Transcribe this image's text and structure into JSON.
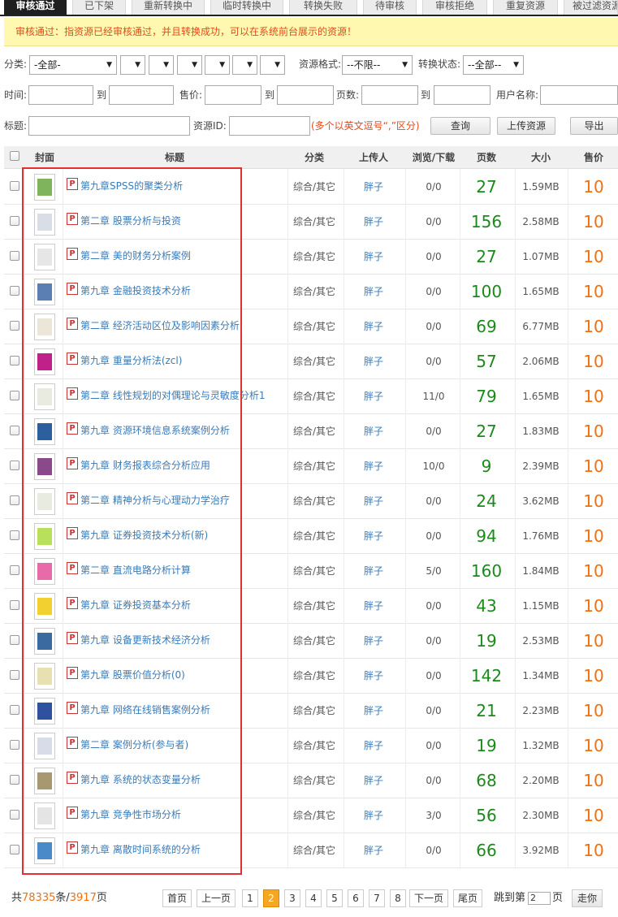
{
  "tabs": [
    "审核通过",
    "已下架",
    "重新转换中",
    "临时转换中",
    "转换失败",
    "待审核",
    "审核拒绝",
    "重复资源",
    "被过滤资源"
  ],
  "notice": "审核通过：指资源已经审核通过，并且转换成功，可以在系统前台展示的资源！",
  "filters": {
    "category_label": "分类:",
    "category_value": "-全部-",
    "format_label": "资源格式:",
    "format_value": "--不限--",
    "convert_label": "转换状态:",
    "convert_value": "--全部--",
    "time_label": "时间:",
    "to_label": "到",
    "price_label": "售价:",
    "pages_label": "页数:",
    "user_label": "用户名称:",
    "title_label": "标题:",
    "resid_label": "资源ID:",
    "resid_hint": "(多个以英文逗号“,”区分)",
    "query_btn": "查询",
    "upload_btn": "上传资源",
    "export_btn": "导出"
  },
  "table": {
    "headers": [
      "封面",
      "标题",
      "分类",
      "上传人",
      "浏览/下载",
      "页数",
      "大小",
      "售价"
    ],
    "file_icon": "P",
    "rows": [
      {
        "title": "第九章SPSS的聚类分析",
        "category": "综合/其它",
        "uploader": "胖子",
        "views": "0/0",
        "pages": "27",
        "size": "1.59MB",
        "price": "10",
        "cover": "#7fb35c"
      },
      {
        "title": "第二章 股票分析与投资",
        "category": "综合/其它",
        "uploader": "胖子",
        "views": "0/0",
        "pages": "156",
        "size": "2.58MB",
        "price": "10",
        "cover": "#d9dde6"
      },
      {
        "title": "第二章 美的财务分析案例",
        "category": "综合/其它",
        "uploader": "胖子",
        "views": "0/0",
        "pages": "27",
        "size": "1.07MB",
        "price": "10",
        "cover": "#e6e6e6"
      },
      {
        "title": "第九章 金融投资技术分析",
        "category": "综合/其它",
        "uploader": "胖子",
        "views": "0/0",
        "pages": "100",
        "size": "1.65MB",
        "price": "10",
        "cover": "#5b7fb3"
      },
      {
        "title": "第二章 经济活动区位及影响因素分析",
        "category": "综合/其它",
        "uploader": "胖子",
        "views": "0/0",
        "pages": "69",
        "size": "6.77MB",
        "price": "10",
        "cover": "#ece6d8"
      },
      {
        "title": "第九章 重量分析法(zcl)",
        "category": "综合/其它",
        "uploader": "胖子",
        "views": "0/0",
        "pages": "57",
        "size": "2.06MB",
        "price": "10",
        "cover": "#c0208a"
      },
      {
        "title": "第二章 线性规划的对偶理论与灵敏度分析1",
        "category": "综合/其它",
        "uploader": "胖子",
        "views": "11/0",
        "pages": "79",
        "size": "1.65MB",
        "price": "10",
        "cover": "#e9ebe0"
      },
      {
        "title": "第九章 资源环境信息系统案例分析",
        "category": "综合/其它",
        "uploader": "胖子",
        "views": "0/0",
        "pages": "27",
        "size": "1.83MB",
        "price": "10",
        "cover": "#2b5f9e"
      },
      {
        "title": "第九章 财务报表综合分析应用",
        "category": "综合/其它",
        "uploader": "胖子",
        "views": "10/0",
        "pages": "9",
        "size": "2.39MB",
        "price": "10",
        "cover": "#8a4a8a"
      },
      {
        "title": "第二章 精神分析与心理动力学治疗",
        "category": "综合/其它",
        "uploader": "胖子",
        "views": "0/0",
        "pages": "24",
        "size": "3.62MB",
        "price": "10",
        "cover": "#e8ece0"
      },
      {
        "title": "第九章 证券投资技术分析(新)",
        "category": "综合/其它",
        "uploader": "胖子",
        "views": "0/0",
        "pages": "94",
        "size": "1.76MB",
        "price": "10",
        "cover": "#b8e05a"
      },
      {
        "title": "第二章 直流电路分析计算",
        "category": "综合/其它",
        "uploader": "胖子",
        "views": "5/0",
        "pages": "160",
        "size": "1.84MB",
        "price": "10",
        "cover": "#e86aa8"
      },
      {
        "title": "第九章 证券投资基本分析",
        "category": "综合/其它",
        "uploader": "胖子",
        "views": "0/0",
        "pages": "43",
        "size": "1.15MB",
        "price": "10",
        "cover": "#f2d030"
      },
      {
        "title": "第九章 设备更新技术经济分析",
        "category": "综合/其它",
        "uploader": "胖子",
        "views": "0/0",
        "pages": "19",
        "size": "2.53MB",
        "price": "10",
        "cover": "#3a6aa0"
      },
      {
        "title": "第九章 股票价值分析(0)",
        "category": "综合/其它",
        "uploader": "胖子",
        "views": "0/0",
        "pages": "142",
        "size": "1.34MB",
        "price": "10",
        "cover": "#e8e0b0"
      },
      {
        "title": "第九章 网络在线销售案例分析",
        "category": "综合/其它",
        "uploader": "胖子",
        "views": "0/0",
        "pages": "21",
        "size": "2.23MB",
        "price": "10",
        "cover": "#3050a0"
      },
      {
        "title": "第二章 案例分析(参与者)",
        "category": "综合/其它",
        "uploader": "胖子",
        "views": "0/0",
        "pages": "19",
        "size": "1.32MB",
        "price": "10",
        "cover": "#d8dce8"
      },
      {
        "title": "第九章 系统的状态变量分析",
        "category": "综合/其它",
        "uploader": "胖子",
        "views": "0/0",
        "pages": "68",
        "size": "2.20MB",
        "price": "10",
        "cover": "#a89870"
      },
      {
        "title": "第九章 竞争性市场分析",
        "category": "综合/其它",
        "uploader": "胖子",
        "views": "3/0",
        "pages": "56",
        "size": "2.30MB",
        "price": "10",
        "cover": "#e4e4e4"
      },
      {
        "title": "第九章 离散时间系统的分析",
        "category": "综合/其它",
        "uploader": "胖子",
        "views": "0/0",
        "pages": "66",
        "size": "3.92MB",
        "price": "10",
        "cover": "#4a8ac8"
      }
    ]
  },
  "footer": {
    "total_prefix": "共",
    "total_count": "78335",
    "total_mid": "条/",
    "total_pages": "3917",
    "total_suffix": "页",
    "first": "首页",
    "prev": "上一页",
    "pages": [
      "1",
      "2",
      "3",
      "4",
      "5",
      "6",
      "7",
      "8"
    ],
    "current_page": "2",
    "next": "下一页",
    "last": "尾页",
    "jump_prefix": "跳到第",
    "jump_value": "2",
    "jump_suffix": "页",
    "go": "走你"
  }
}
